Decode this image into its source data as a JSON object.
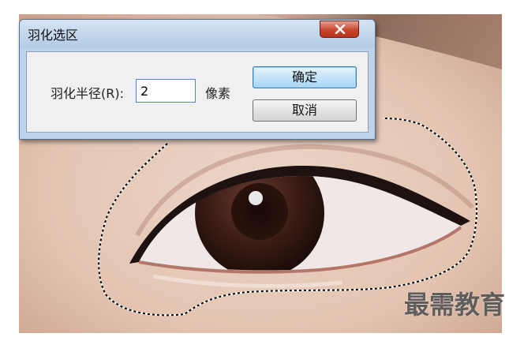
{
  "dialog": {
    "title": "羽化选区",
    "radius_label": "羽化半径(R):",
    "radius_value": "2",
    "unit_label": "像素",
    "ok_label": "确定",
    "cancel_label": "取消"
  },
  "watermark": {
    "text": "最需教育"
  },
  "icons": {
    "close": "close-icon"
  },
  "colors": {
    "ok_border": "#3c7fb1",
    "close_button": "#c9462b",
    "title_bar": "#bcd3ea"
  }
}
